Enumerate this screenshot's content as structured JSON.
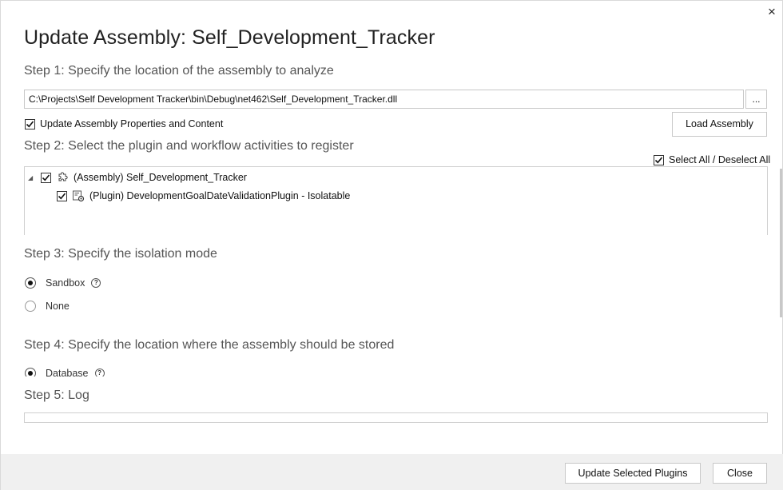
{
  "dialog": {
    "title": "Update Assembly: Self_Development_Tracker",
    "close_label": "×"
  },
  "step1": {
    "heading": "Step 1: Specify the location of the assembly to analyze",
    "path_value": "C:\\Projects\\Self Development Tracker\\bin\\Debug\\net462\\Self_Development_Tracker.dll",
    "browse_label": "...",
    "update_props_label": "Update Assembly Properties and Content",
    "update_props_checked": true,
    "load_button_label": "Load Assembly"
  },
  "step2": {
    "heading": "Step 2: Select the plugin and workflow activities to register",
    "select_all_label": "Select All / Deselect All",
    "select_all_checked": true,
    "tree": [
      {
        "label": "(Assembly) Self_Development_Tracker",
        "checked": true,
        "icon": "puzzle-icon",
        "expander": "◢"
      },
      {
        "label": "(Plugin) DevelopmentGoalDateValidationPlugin - Isolatable",
        "checked": true,
        "icon": "plugin-gear-icon"
      }
    ]
  },
  "step3": {
    "heading": "Step 3: Specify the isolation mode",
    "options": [
      {
        "label": "Sandbox",
        "selected": true,
        "help": "?"
      },
      {
        "label": "None",
        "selected": false
      }
    ]
  },
  "step4": {
    "heading": "Step 4: Specify the location where the assembly should be stored",
    "options": [
      {
        "label": "Database",
        "selected": true,
        "help": "?"
      }
    ]
  },
  "step5": {
    "heading": "Step 5: Log"
  },
  "footer": {
    "update_button_label": "Update Selected Plugins",
    "close_button_label": "Close"
  }
}
